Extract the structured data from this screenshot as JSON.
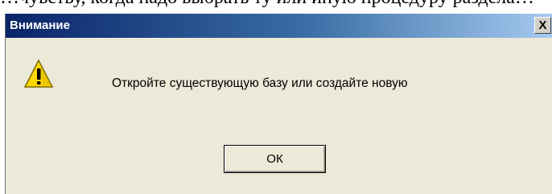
{
  "document": {
    "text_fragment": "…чувству, когда надо выбрать ту или иную процедуру раздела…"
  },
  "dialog": {
    "title": "Внимание",
    "close_label": "X",
    "icon": "warning-icon",
    "message": "Откройте существующую базу или создайте новую",
    "ok_label": "ОК",
    "colors": {
      "titlebar_start": "#0a246a",
      "titlebar_end": "#a6caf0",
      "face": "#ece9d8",
      "warning_yellow": "#ffd800"
    }
  }
}
